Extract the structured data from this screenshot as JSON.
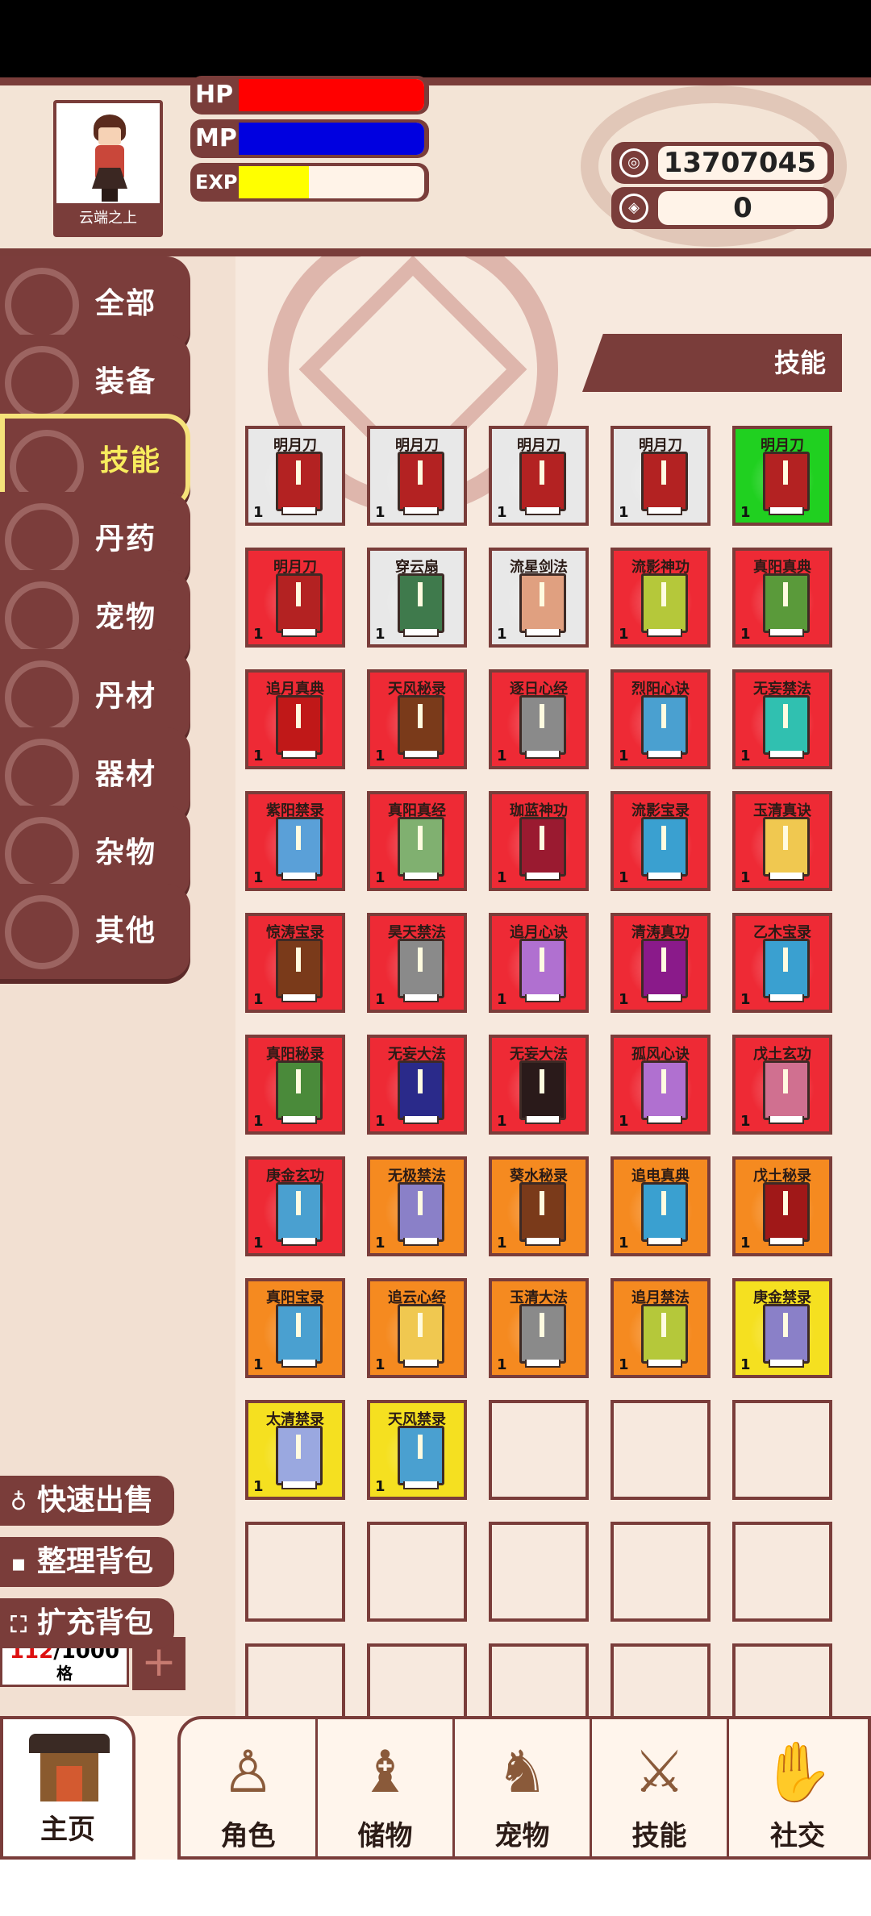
{
  "player": {
    "name": "云端之上"
  },
  "stats": [
    {
      "label": "HP",
      "fill": 1.0,
      "color": "#ff0000"
    },
    {
      "label": "MP",
      "fill": 1.0,
      "color": "#0000e0"
    },
    {
      "label": "EXP",
      "fill": 0.38,
      "color": "#ffff00"
    }
  ],
  "currency": [
    {
      "icon": "coin-icon",
      "value": "13707045"
    },
    {
      "icon": "gem-icon",
      "value": "0"
    }
  ],
  "categories": [
    "全部",
    "装备",
    "技能",
    "丹药",
    "宠物",
    "丹材",
    "器材",
    "杂物",
    "其他"
  ],
  "active_category": 2,
  "capacity": {
    "used": "112",
    "total": "/1000",
    "unit": "格"
  },
  "actions": [
    {
      "icon": "bag-icon",
      "label": "快速出售"
    },
    {
      "icon": "grid-icon",
      "label": "整理背包"
    },
    {
      "icon": "expand-icon",
      "label": "扩充背包"
    }
  ],
  "section_title": "技能",
  "items": [
    {
      "name": "明月刀",
      "bg": "#e8e8e8",
      "book": "#b32222",
      "qty": "1"
    },
    {
      "name": "明月刀",
      "bg": "#e8e8e8",
      "book": "#b32222",
      "qty": "1"
    },
    {
      "name": "明月刀",
      "bg": "#e8e8e8",
      "book": "#b32222",
      "qty": "1"
    },
    {
      "name": "明月刀",
      "bg": "#e8e8e8",
      "book": "#b32222",
      "qty": "1"
    },
    {
      "name": "明月刀",
      "bg": "#20d020",
      "book": "#b32222",
      "qty": "1"
    },
    {
      "name": "明月刀",
      "bg": "#ee2a35",
      "book": "#b32222",
      "qty": "1"
    },
    {
      "name": "穿云扇",
      "bg": "#e8e8e8",
      "book": "#3f7a4c",
      "qty": "1"
    },
    {
      "name": "流星剑法",
      "bg": "#e8e8e8",
      "book": "#e0a080",
      "qty": "1"
    },
    {
      "name": "流影神功",
      "bg": "#ee2a35",
      "book": "#b5c83a",
      "qty": "1"
    },
    {
      "name": "真阳真典",
      "bg": "#ee2a35",
      "book": "#5a9a3a",
      "qty": "1"
    },
    {
      "name": "追月真典",
      "bg": "#ee2a35",
      "book": "#c01818",
      "qty": "1"
    },
    {
      "name": "天风秘录",
      "bg": "#ee2a35",
      "book": "#7a3a1a",
      "qty": "1"
    },
    {
      "name": "逐日心经",
      "bg": "#ee2a35",
      "book": "#8a8a8a",
      "qty": "1"
    },
    {
      "name": "烈阳心诀",
      "bg": "#ee2a35",
      "book": "#4aa0d0",
      "qty": "1"
    },
    {
      "name": "无妄禁法",
      "bg": "#ee2a35",
      "book": "#30c0b0",
      "qty": "1"
    },
    {
      "name": "紫阳禁录",
      "bg": "#ee2a35",
      "book": "#5aa0d8",
      "qty": "1"
    },
    {
      "name": "真阳真经",
      "bg": "#ee2a35",
      "book": "#80b070",
      "qty": "1"
    },
    {
      "name": "珈蓝神功",
      "bg": "#ee2a35",
      "book": "#9a1a30",
      "qty": "1"
    },
    {
      "name": "流影宝录",
      "bg": "#ee2a35",
      "book": "#3aa0d0",
      "qty": "1"
    },
    {
      "name": "玉清真诀",
      "bg": "#ee2a35",
      "book": "#f0c850",
      "qty": "1"
    },
    {
      "name": "惊涛宝录",
      "bg": "#ee2a35",
      "book": "#7a3a1a",
      "qty": "1"
    },
    {
      "name": "昊天禁法",
      "bg": "#ee2a35",
      "book": "#8a8a8a",
      "qty": "1"
    },
    {
      "name": "追月心诀",
      "bg": "#ee2a35",
      "book": "#b070d0",
      "qty": "1"
    },
    {
      "name": "清涛真功",
      "bg": "#ee2a35",
      "book": "#8a1a8a",
      "qty": "1"
    },
    {
      "name": "乙木宝录",
      "bg": "#ee2a35",
      "book": "#3aa0d0",
      "qty": "1"
    },
    {
      "name": "真阳秘录",
      "bg": "#ee2a35",
      "book": "#4a8a3a",
      "qty": "1"
    },
    {
      "name": "无妄大法",
      "bg": "#ee2a35",
      "book": "#2a2a8a",
      "qty": "1"
    },
    {
      "name": "无妄大法",
      "bg": "#ee2a35",
      "book": "#2a1a1a",
      "qty": "1"
    },
    {
      "name": "孤风心诀",
      "bg": "#ee2a35",
      "book": "#b070d0",
      "qty": "1"
    },
    {
      "name": "戊土玄功",
      "bg": "#ee2a35",
      "book": "#d07090",
      "qty": "1"
    },
    {
      "name": "庚金玄功",
      "bg": "#ee2a35",
      "book": "#4aa0d0",
      "qty": "1"
    },
    {
      "name": "无极禁法",
      "bg": "#f58a20",
      "book": "#8a80c8",
      "qty": "1"
    },
    {
      "name": "葵水秘录",
      "bg": "#f58a20",
      "book": "#7a3a1a",
      "qty": "1"
    },
    {
      "name": "追电真典",
      "bg": "#f58a20",
      "book": "#3aa0d0",
      "qty": "1"
    },
    {
      "name": "戊土秘录",
      "bg": "#f58a20",
      "book": "#a01818",
      "qty": "1"
    },
    {
      "name": "真阳宝录",
      "bg": "#f58a20",
      "book": "#4aa0d0",
      "qty": "1"
    },
    {
      "name": "追云心经",
      "bg": "#f58a20",
      "book": "#f0c850",
      "qty": "1"
    },
    {
      "name": "玉清大法",
      "bg": "#f58a20",
      "book": "#8a8a8a",
      "qty": "1"
    },
    {
      "name": "追月禁法",
      "bg": "#f58a20",
      "book": "#b5c83a",
      "qty": "1"
    },
    {
      "name": "庚金禁录",
      "bg": "#f5e020",
      "book": "#8a80c8",
      "qty": "1"
    },
    {
      "name": "太清禁录",
      "bg": "#f5e020",
      "book": "#9aa8e0",
      "qty": "1"
    },
    {
      "name": "天风禁录",
      "bg": "#f5e020",
      "book": "#4aa0d0",
      "qty": "1"
    }
  ],
  "empty_slots": 13,
  "nav": [
    {
      "label": "主页",
      "icon": "home-gate-icon"
    },
    {
      "label": "角色",
      "icon": "character-icon"
    },
    {
      "label": "储物",
      "icon": "storage-bag-icon"
    },
    {
      "label": "宠物",
      "icon": "pet-fox-icon"
    },
    {
      "label": "技能",
      "icon": "sword-icon"
    },
    {
      "label": "社交",
      "icon": "handshake-icon"
    }
  ]
}
